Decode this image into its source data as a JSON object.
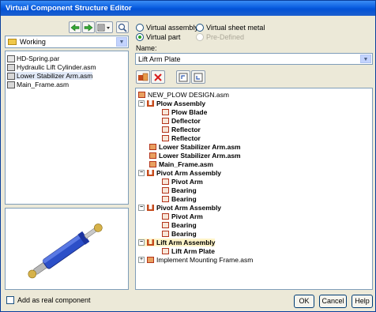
{
  "window": {
    "title": "Virtual Component Structure Editor"
  },
  "left": {
    "folder_combo": "Working",
    "files": [
      "HD-Spring.par",
      "Hydraulic Lift Cylinder.asm",
      "Lower Stabilizer Arm.asm",
      "Main_Frame.asm"
    ],
    "add_as_real": "Add as real component"
  },
  "right": {
    "radios": {
      "virtual_assembly": "Virtual assembly",
      "virtual_sheet_metal": "Virtual sheet metal",
      "virtual_part": "Virtual part",
      "predefined": "Pre-Defined"
    },
    "name_label": "Name:",
    "name_value": "Lift Arm Plate",
    "tree": [
      {
        "text": "NEW_PLOW DESIGN.asm",
        "bold": false,
        "icon": "assembly-root"
      },
      {
        "text": "Plow Assembly",
        "bold": true,
        "icon": "assembly"
      },
      {
        "text": "Plow Blade",
        "bold": true,
        "icon": "part"
      },
      {
        "text": "Deflector",
        "bold": true,
        "icon": "part"
      },
      {
        "text": "Reflector",
        "bold": true,
        "icon": "part"
      },
      {
        "text": "Reflector",
        "bold": true,
        "icon": "part"
      },
      {
        "text": "Lower Stabilizer Arm.asm",
        "bold": true,
        "icon": "subassembly"
      },
      {
        "text": "Lower Stabilizer Arm.asm",
        "bold": true,
        "icon": "subassembly"
      },
      {
        "text": "Main_Frame.asm",
        "bold": true,
        "icon": "subassembly"
      },
      {
        "text": "Pivot Arm Assembly",
        "bold": true,
        "icon": "assembly"
      },
      {
        "text": "Pivot Arm",
        "bold": true,
        "icon": "part"
      },
      {
        "text": "Bearing",
        "bold": true,
        "icon": "part"
      },
      {
        "text": "Bearing",
        "bold": true,
        "icon": "part"
      },
      {
        "text": "Pivot Arm Assembly",
        "bold": true,
        "icon": "assembly"
      },
      {
        "text": "Pivot Arm",
        "bold": true,
        "icon": "part"
      },
      {
        "text": "Bearing",
        "bold": true,
        "icon": "part"
      },
      {
        "text": "Bearing",
        "bold": true,
        "icon": "part"
      },
      {
        "text": "Lift Arm Assembly",
        "bold": true,
        "icon": "assembly"
      },
      {
        "text": "Lift Arm Plate",
        "bold": true,
        "icon": "part"
      },
      {
        "text": "Implement Mounting Frame.asm",
        "bold": false,
        "icon": "subassembly"
      }
    ]
  },
  "buttons": {
    "ok": "OK",
    "cancel": "Cancel",
    "help": "Help"
  }
}
